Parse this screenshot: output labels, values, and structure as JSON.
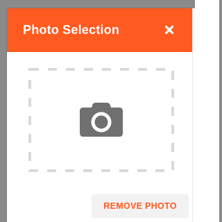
{
  "dialog": {
    "title": "Photo Selection",
    "close_icon": "close-icon",
    "header_color": "#ff5a1f"
  },
  "dropzone": {
    "icon": "camera-icon",
    "border_style": "dashed"
  },
  "actions": {
    "remove_label": "REMOVE PHOTO",
    "accent_color": "#ff5a1f"
  }
}
